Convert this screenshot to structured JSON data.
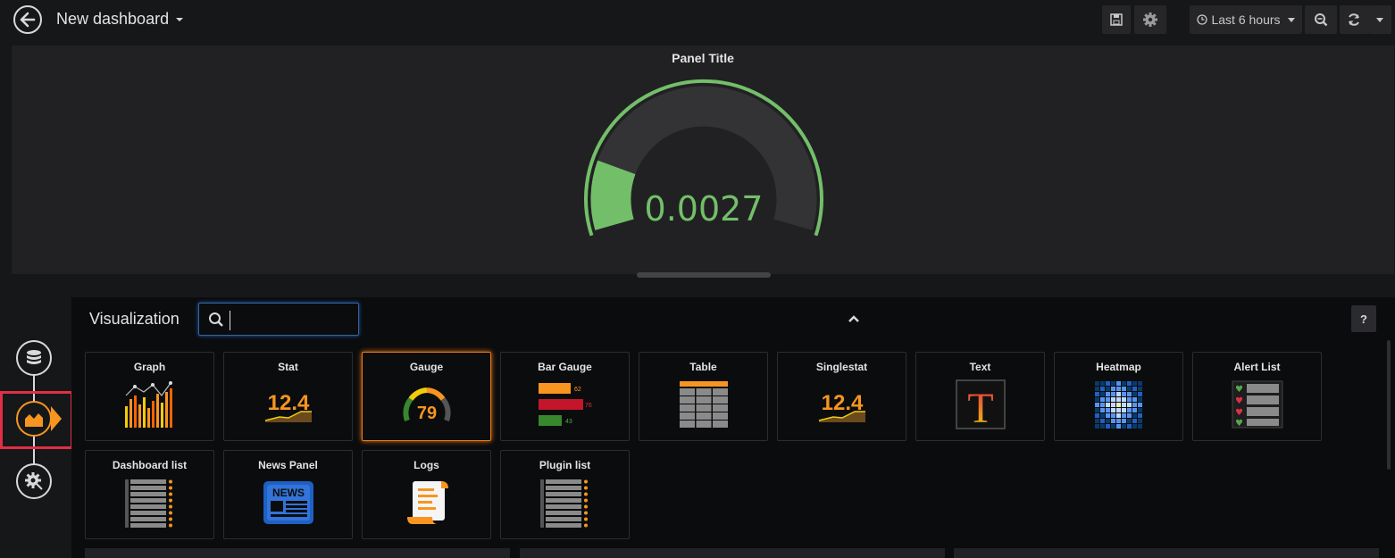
{
  "header": {
    "title": "New dashboard",
    "time_range": "Last 6 hours"
  },
  "panel": {
    "title": "Panel Title",
    "gauge_value": "0.0027",
    "gauge_fraction": 0.17,
    "colors": {
      "value": "#73bf69",
      "track": "#333336"
    }
  },
  "editor": {
    "label": "Visualization",
    "search": {
      "value": "",
      "placeholder": ""
    },
    "help": "?",
    "selected": "Gauge",
    "visualizations": [
      {
        "name": "Graph",
        "icon": "graph-icon"
      },
      {
        "name": "Stat",
        "icon": "stat-icon",
        "sample": "12.4"
      },
      {
        "name": "Gauge",
        "icon": "gauge-icon",
        "sample": "79"
      },
      {
        "name": "Bar Gauge",
        "icon": "bar-gauge-icon",
        "samples": [
          "62",
          "76",
          "43"
        ]
      },
      {
        "name": "Table",
        "icon": "table-icon"
      },
      {
        "name": "Singlestat",
        "icon": "singlestat-icon",
        "sample": "12.4"
      },
      {
        "name": "Text",
        "icon": "text-icon",
        "sample": "T"
      },
      {
        "name": "Heatmap",
        "icon": "heatmap-icon"
      },
      {
        "name": "Alert List",
        "icon": "alert-list-icon"
      },
      {
        "name": "Dashboard list",
        "icon": "dashboard-list-icon"
      },
      {
        "name": "News Panel",
        "icon": "news-panel-icon",
        "sample": "NEWS"
      },
      {
        "name": "Logs",
        "icon": "logs-icon"
      },
      {
        "name": "Plugin list",
        "icon": "plugin-list-icon"
      }
    ]
  },
  "rail": [
    "database-icon",
    "visualization-icon",
    "general-settings-icon"
  ],
  "colors": {
    "accent": "#f79520",
    "highlight": "#e02f44",
    "background": "#161719"
  }
}
